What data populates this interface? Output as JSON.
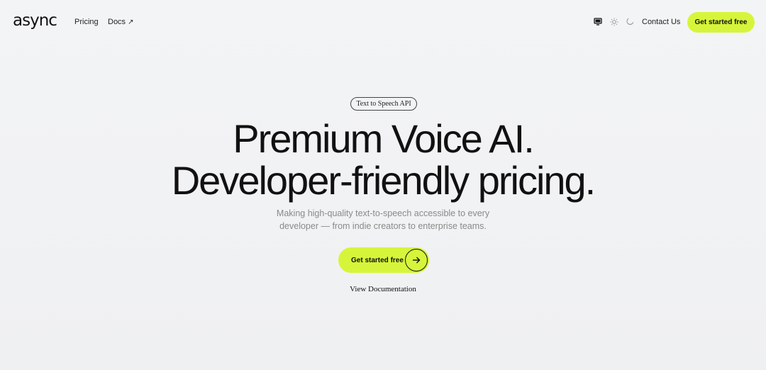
{
  "header": {
    "logo": "async",
    "nav": {
      "pricing": "Pricing",
      "docs": "Docs",
      "docs_arrow": "↗"
    },
    "theme_icons": [
      "monitor-icon",
      "sun-icon",
      "moon-icon"
    ],
    "contact": "Contact Us",
    "cta": "Get started free"
  },
  "hero": {
    "badge": "Text to Speech API",
    "headline_line1": "Premium Voice AI.",
    "headline_line2": "Developer-friendly pricing.",
    "sub_line1": "Making high-quality text-to-speech accessible to every",
    "sub_line2": "developer — from indie creators to enterprise teams.",
    "cta": "Get started free",
    "cta_arrow": "→",
    "docs_link": "View Documentation"
  },
  "colors": {
    "accent": "#d6f53a",
    "background": "#f1f2f3",
    "text": "#111111",
    "muted": "#8a8a8a"
  }
}
